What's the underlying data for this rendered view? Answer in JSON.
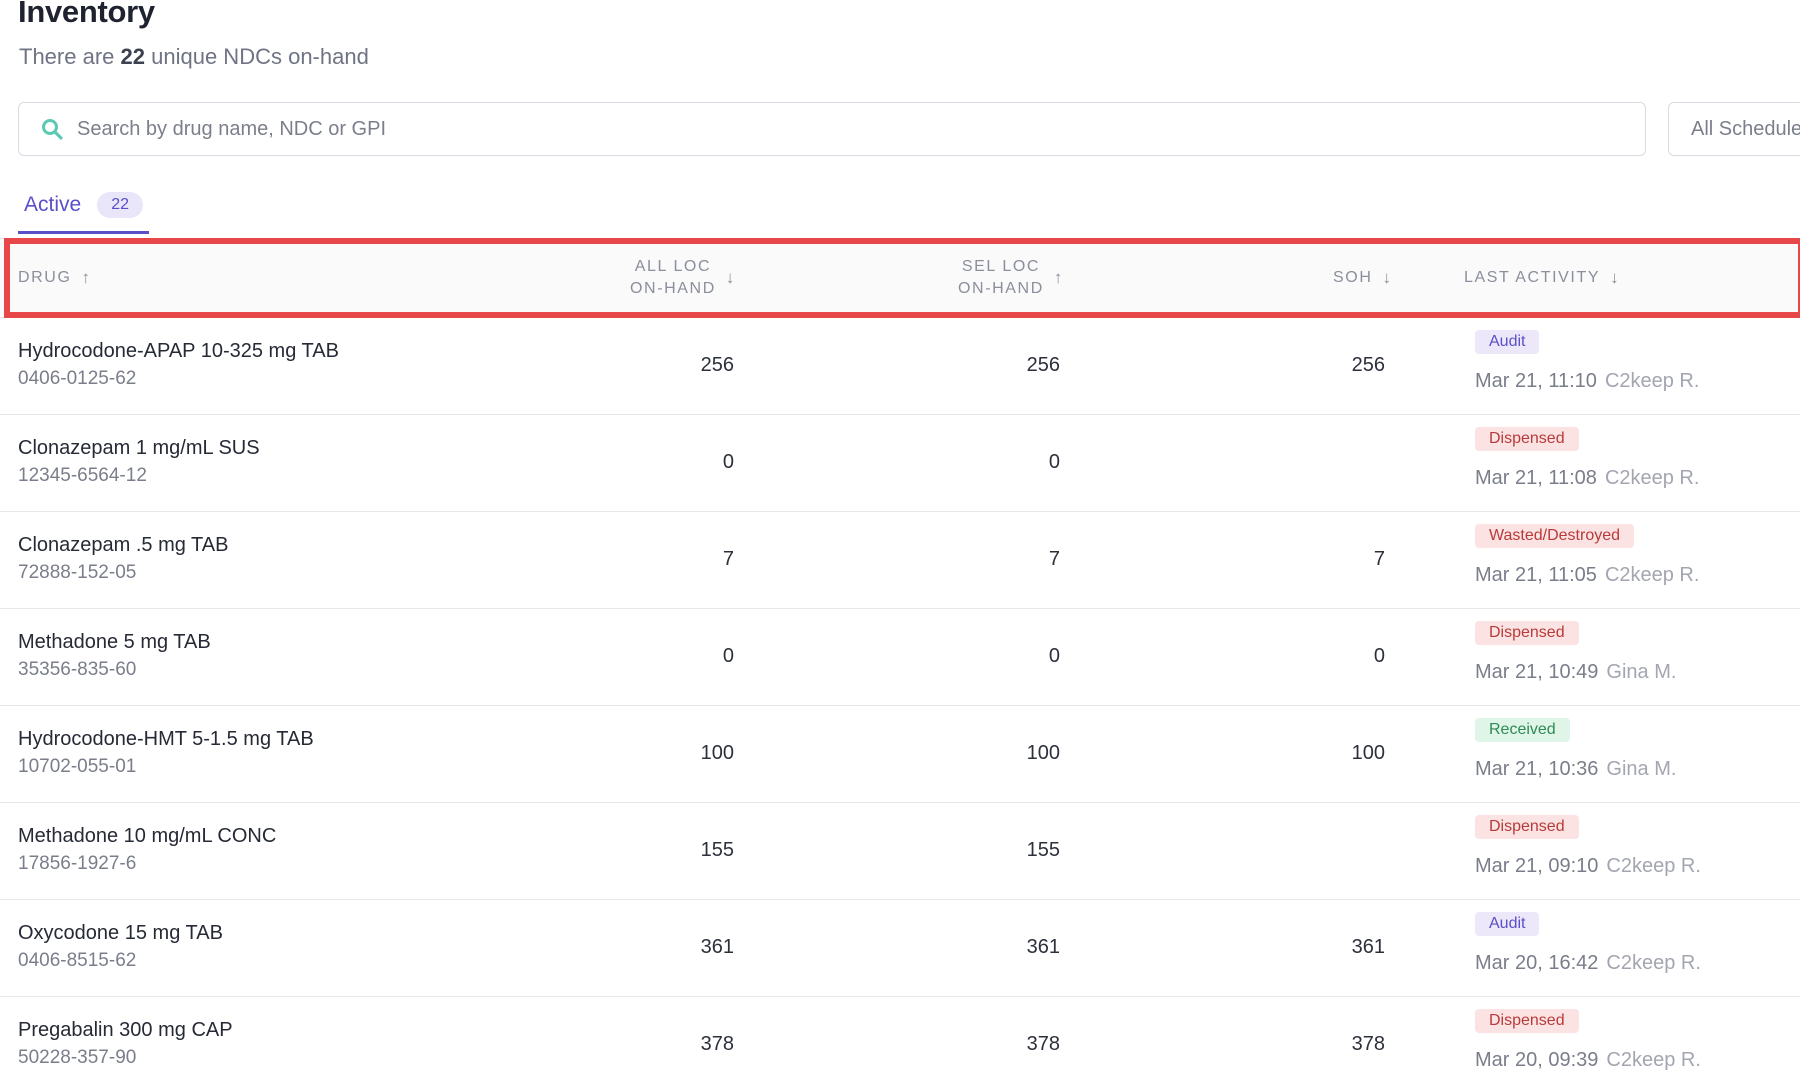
{
  "header": {
    "title": "Inventory",
    "subtitle_prefix": "There are",
    "subtitle_count": "22",
    "subtitle_suffix": "unique NDCs on-hand"
  },
  "search": {
    "placeholder": "Search by drug name, NDC or GPI",
    "value": ""
  },
  "schedule_filter": {
    "label": "All Schedule"
  },
  "tabs": [
    {
      "label": "Active",
      "count": "22"
    }
  ],
  "table": {
    "columns": {
      "drug": {
        "label": "DRUG",
        "sort": "↑"
      },
      "all_loc": {
        "label_line1": "ALL LOC",
        "label_line2": "ON-HAND",
        "sort": "↓"
      },
      "sel_loc": {
        "label_line1": "SEL LOC",
        "label_line2": "ON-HAND",
        "sort": "↑"
      },
      "soh": {
        "label": "SOH",
        "sort": "↓"
      },
      "last_activity": {
        "label": "LAST ACTIVITY",
        "sort": "↓"
      }
    },
    "rows": [
      {
        "drug": "Hydrocodone-APAP 10-325 mg TAB",
        "ndc": "0406-0125-62",
        "all_loc": "256",
        "sel_loc": "256",
        "soh": "256",
        "status": "Audit",
        "status_type": "audit",
        "time": "Mar 21, 11:10",
        "user": "C2keep R."
      },
      {
        "drug": "Clonazepam 1 mg/mL SUS",
        "ndc": "12345-6564-12",
        "all_loc": "0",
        "sel_loc": "0",
        "soh": "",
        "status": "Dispensed",
        "status_type": "dispensed",
        "time": "Mar 21, 11:08",
        "user": "C2keep R."
      },
      {
        "drug": "Clonazepam .5 mg TAB",
        "ndc": "72888-152-05",
        "all_loc": "7",
        "sel_loc": "7",
        "soh": "7",
        "status": "Wasted/Destroyed",
        "status_type": "wasted",
        "time": "Mar 21, 11:05",
        "user": "C2keep R."
      },
      {
        "drug": "Methadone 5 mg TAB",
        "ndc": "35356-835-60",
        "all_loc": "0",
        "sel_loc": "0",
        "soh": "0",
        "status": "Dispensed",
        "status_type": "dispensed",
        "time": "Mar 21, 10:49",
        "user": "Gina M."
      },
      {
        "drug": "Hydrocodone-HMT 5-1.5 mg TAB",
        "ndc": "10702-055-01",
        "all_loc": "100",
        "sel_loc": "100",
        "soh": "100",
        "status": "Received",
        "status_type": "received",
        "time": "Mar 21, 10:36",
        "user": "Gina M."
      },
      {
        "drug": "Methadone 10 mg/mL CONC",
        "ndc": "17856-1927-6",
        "all_loc": "155",
        "sel_loc": "155",
        "soh": "",
        "status": "Dispensed",
        "status_type": "dispensed",
        "time": "Mar 21, 09:10",
        "user": "C2keep R."
      },
      {
        "drug": "Oxycodone 15 mg TAB",
        "ndc": "0406-8515-62",
        "all_loc": "361",
        "sel_loc": "361",
        "soh": "361",
        "status": "Audit",
        "status_type": "audit",
        "time": "Mar 20, 16:42",
        "user": "C2keep R."
      },
      {
        "drug": "Pregabalin 300 mg CAP",
        "ndc": "50228-357-90",
        "all_loc": "378",
        "sel_loc": "378",
        "soh": "378",
        "status": "Dispensed",
        "status_type": "dispensed",
        "time": "Mar 20, 09:39",
        "user": "C2keep R."
      }
    ]
  },
  "colors": {
    "accent": "#5b4fc8",
    "highlight": "#e8474a",
    "search_icon": "#5cc9b5"
  },
  "icons": {
    "search": "search-icon"
  }
}
